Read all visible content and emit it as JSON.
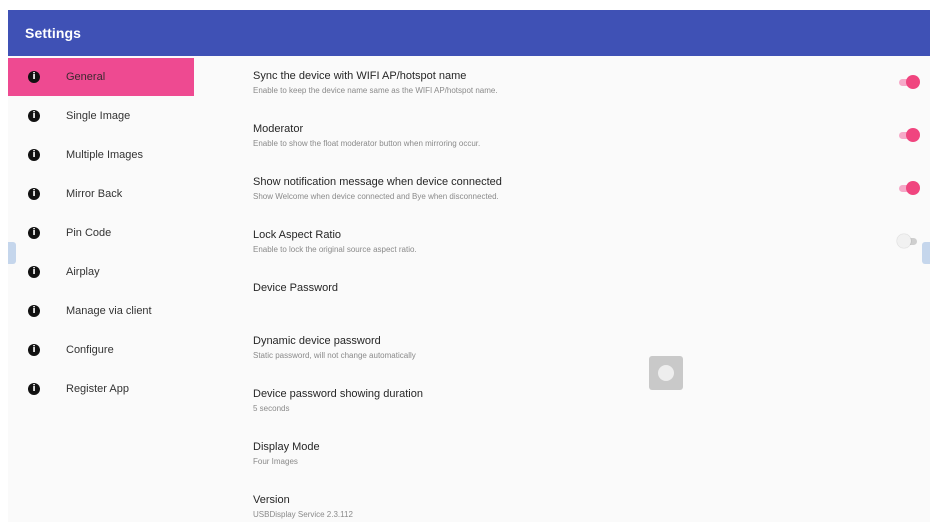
{
  "appbar": {
    "title": "Settings",
    "color": "#3f51b5"
  },
  "accent_color": "#ee4a91",
  "sidebar": {
    "items": [
      {
        "label": "General",
        "icon": "info-icon",
        "active": true
      },
      {
        "label": "Single Image",
        "icon": "info-icon",
        "active": false
      },
      {
        "label": "Multiple Images",
        "icon": "info-icon",
        "active": false
      },
      {
        "label": "Mirror Back",
        "icon": "info-icon",
        "active": false
      },
      {
        "label": "Pin Code",
        "icon": "info-icon",
        "active": false
      },
      {
        "label": "Airplay",
        "icon": "info-icon",
        "active": false
      },
      {
        "label": "Manage via client",
        "icon": "info-icon",
        "active": false
      },
      {
        "label": "Configure",
        "icon": "info-icon",
        "active": false
      },
      {
        "label": "Register App",
        "icon": "info-icon",
        "active": false
      }
    ]
  },
  "settings": [
    {
      "title": "Sync the device with WIFI AP/hotspot name",
      "subtitle": "Enable to keep the device name same as the WIFI AP/hotspot name.",
      "toggle": true
    },
    {
      "title": "Moderator",
      "subtitle": "Enable to show the float moderator button when mirroring occur.",
      "toggle": true
    },
    {
      "title": "Show notification message when device connected",
      "subtitle": "Show Welcome when device connected and Bye when disconnected.",
      "toggle": true
    },
    {
      "title": "Lock Aspect Ratio",
      "subtitle": "Enable to lock the original source aspect ratio.",
      "toggle": false
    },
    {
      "title": "Device Password",
      "subtitle": ""
    },
    {
      "title": "Dynamic device password",
      "subtitle": "Static password, will not change automatically"
    },
    {
      "title": "Device password showing duration",
      "subtitle": "5 seconds"
    },
    {
      "title": "Display Mode",
      "subtitle": "Four Images"
    },
    {
      "title": "Version",
      "subtitle": "USBDisplay Service 2.3.112"
    }
  ]
}
